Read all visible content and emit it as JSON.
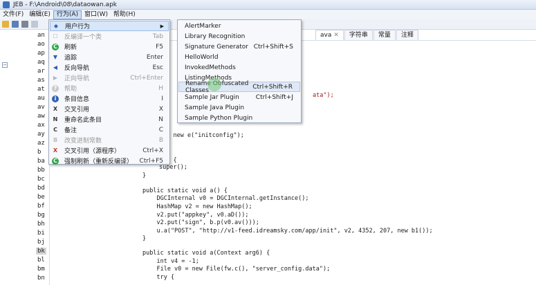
{
  "window": {
    "title": "JEB - F:\\Android\\08\\dataowan.apk"
  },
  "menubar": [
    "文件(F)",
    "编辑(E)",
    "行为(A)",
    "窗口(W)",
    "帮助(H)"
  ],
  "tree": {
    "collapse_symbol": "−",
    "items": [
      "an",
      "ao",
      "ap",
      "aq",
      "ar",
      "as",
      "at",
      "au",
      "av",
      "aw",
      "ax",
      "ay",
      "az",
      "b",
      "ba",
      "bb",
      "bc",
      "bd",
      "be",
      "bf",
      "bg",
      "bh",
      "bi",
      "bj",
      "bk",
      "bl",
      "bm",
      "bn"
    ],
    "selected": "bk"
  },
  "tabs": [
    {
      "label": "ava",
      "closable": true
    },
    {
      "label": "字符串",
      "closable": false
    },
    {
      "label": "常量",
      "closable": false
    },
    {
      "label": "注释",
      "closable": false
    }
  ],
  "dropdown": {
    "items": [
      {
        "label": "用户行为",
        "shortcut": "",
        "icon": "user-action-icon",
        "submenu": true,
        "disabled": false
      },
      {
        "label": "反编译一个类",
        "shortcut": "Tab",
        "icon": "decompile-icon",
        "disabled": true
      },
      {
        "label": "刷新",
        "shortcut": "F5",
        "icon": "refresh-icon",
        "disabled": false
      },
      {
        "label": "追踪",
        "shortcut": "Enter",
        "icon": "follow-icon",
        "disabled": false
      },
      {
        "label": "反向导航",
        "shortcut": "Esc",
        "icon": "navigate-back-icon",
        "disabled": false
      },
      {
        "label": "正向导航",
        "shortcut": "Ctrl+Enter",
        "icon": "navigate-forward-icon",
        "disabled": true
      },
      {
        "label": "帮助",
        "shortcut": "H",
        "icon": "help-icon",
        "disabled": true
      },
      {
        "label": "条目信息",
        "shortcut": "I",
        "icon": "info-icon",
        "disabled": false
      },
      {
        "label": "交叉引用",
        "shortcut": "X",
        "icon": "xref-icon",
        "disabled": false
      },
      {
        "label": "重命名此条目",
        "shortcut": "N",
        "icon": "rename-icon",
        "disabled": false
      },
      {
        "label": "备注",
        "shortcut": "C",
        "icon": "comment-icon",
        "disabled": false
      },
      {
        "label": "改变进制常数",
        "shortcut": "B",
        "icon": "base-icon",
        "disabled": true
      },
      {
        "label": "交叉引用（源程序）",
        "shortcut": "Ctrl+X",
        "icon": "xref-source-icon",
        "disabled": false
      },
      {
        "label": "强制刷新（重新反编译）",
        "shortcut": "Ctrl+F5",
        "icon": "force-refresh-icon",
        "disabled": false
      }
    ]
  },
  "submenu": {
    "items": [
      {
        "label": "AlertMarker",
        "shortcut": ""
      },
      {
        "label": "Library Recognition",
        "shortcut": ""
      },
      {
        "label": "Signature Generator",
        "shortcut": "Ctrl+Shift+S"
      },
      {
        "label": "HelloWorld",
        "shortcut": ""
      },
      {
        "label": "InvokedMethods",
        "shortcut": ""
      },
      {
        "label": "ListingMethods",
        "shortcut": ""
      },
      {
        "label": "Rename Obfuscated Classes",
        "shortcut": "Ctrl+Shift+R"
      },
      {
        "label": "Sample Jar Plugin",
        "shortcut": "Ctrl+Shift+J"
      },
      {
        "label": "Sample Java Plugin",
        "shortcut": ""
      },
      {
        "label": "Sample Python Plugin",
        "shortcut": ""
      }
    ]
  },
  "code_fragments": {
    "frag_data": "ata\");",
    "frag_initconfig": "r = new e(\"initconfig\");",
    "frag_k": "k() {",
    "frag_super": "super();",
    "frag_brace": "}",
    "frag_brace2": "}"
  },
  "code": [
    {
      "line": "public static void a() {"
    },
    {
      "line": "    DGCInternal v0 = DGCInternal.getInstance();"
    },
    {
      "line": "    HashMap v2 = new HashMap();"
    },
    {
      "line": "    v2.put(\"appkey\", v0.aD());"
    },
    {
      "line": "    v2.put(\"sign\", b.p(v0.av()));"
    },
    {
      "line": "    u.a(\"POST\", \"http://v1-feed.idreamsky.com/app/init\", v2, 4352, 207, new b1());"
    },
    {
      "line": "}"
    },
    {
      "line": ""
    },
    {
      "line": "public static void a(Context arg6) {"
    },
    {
      "line": "    int v4 = -1;"
    },
    {
      "line": "    File v0 = new File(fw.c(), \"server_config.data\");"
    },
    {
      "line": "    try {"
    }
  ]
}
